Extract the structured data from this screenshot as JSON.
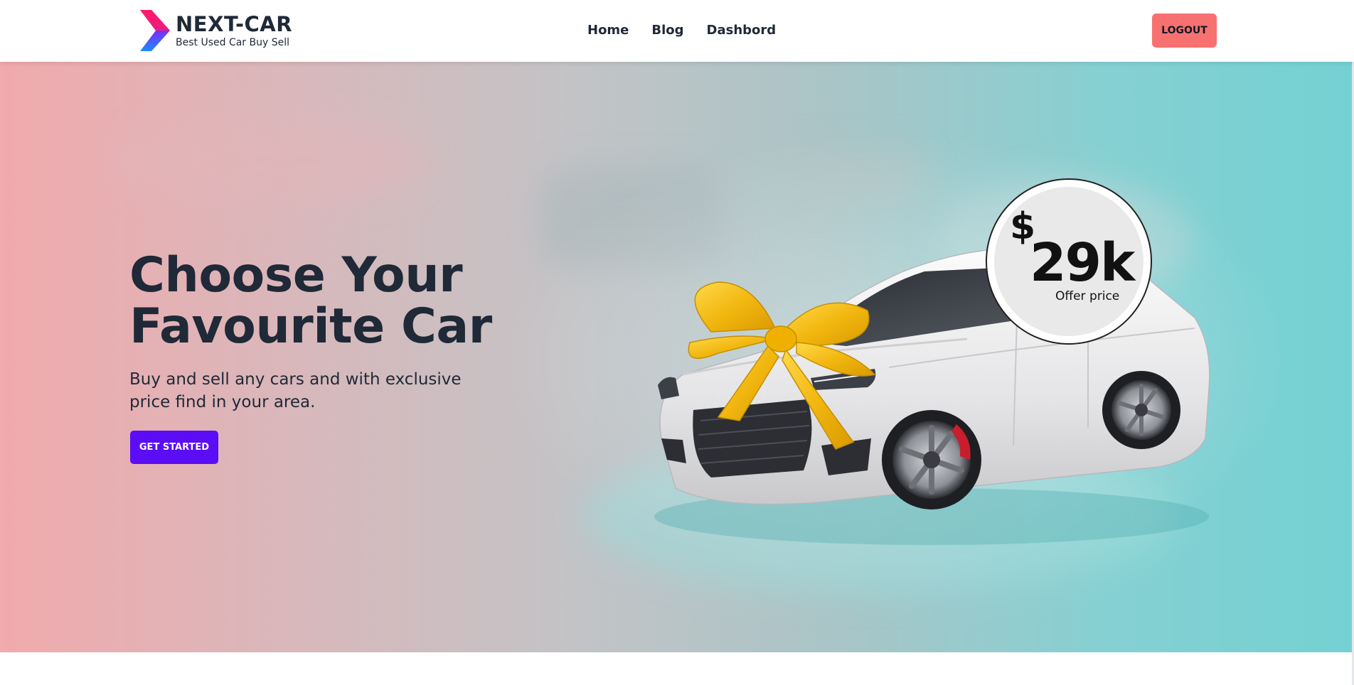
{
  "brand": {
    "name": "NEXT-CAR",
    "tagline": "Best Used Car Buy Sell",
    "logo_icon": "chevron-logo-icon",
    "colors": {
      "logo_top": "#ff1a6a",
      "logo_mid": "#7b2cf5",
      "logo_bottom": "#1a8cff"
    }
  },
  "nav": {
    "links": [
      {
        "label": "Home"
      },
      {
        "label": "Blog"
      },
      {
        "label": "Dashbord"
      }
    ],
    "logout_label": "LOGOUT",
    "logout_color": "#f87171"
  },
  "hero": {
    "title_line1": "Choose Your",
    "title_line2": "Favourite Car",
    "subtitle_line1": "Buy and sell any cars and with exclusive",
    "subtitle_line2": "price find in your area.",
    "cta_label": "GET STARTED",
    "cta_color": "#5b0ef5",
    "gradient_left": "#f1aaad",
    "gradient_right": "#74d1d3"
  },
  "offer": {
    "currency": "$",
    "amount": "29k",
    "label": "Offer price"
  },
  "car_image": {
    "icon": "white-sedan-with-gold-bow-icon",
    "body_color": "#efeff0",
    "bow_color": "#f2c21b",
    "caliper_color": "#c81e2b"
  }
}
